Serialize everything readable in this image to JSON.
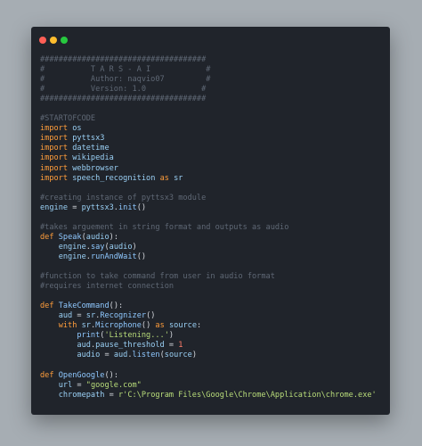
{
  "window": {
    "buttons": [
      {
        "name": "close-button",
        "color": "#ff5f56"
      },
      {
        "name": "minimize-button",
        "color": "#ffbd2e"
      },
      {
        "name": "maximize-button",
        "color": "#27c93f"
      }
    ]
  },
  "colors": {
    "background": "#a6adb3",
    "editor": "#20242b",
    "comment": "#5f6875",
    "keyword": "#ff9d3b",
    "identifier": "#9ad0f5",
    "string": "#b9dd7a",
    "number": "#ff7d6b"
  },
  "code": [
    [
      [
        "cm",
        "####################################"
      ]
    ],
    [
      [
        "cm",
        "#          T A R S - A I            #"
      ]
    ],
    [
      [
        "cm",
        "#          Author: naqvio07         #"
      ]
    ],
    [
      [
        "cm",
        "#          Version: 1.0            #"
      ]
    ],
    [
      [
        "cm",
        "####################################"
      ]
    ],
    [],
    [
      [
        "cm",
        "#STARTOFCODE"
      ]
    ],
    [
      [
        "kw",
        "import"
      ],
      [
        "op",
        " "
      ],
      [
        "id",
        "os"
      ]
    ],
    [
      [
        "kw",
        "import"
      ],
      [
        "op",
        " "
      ],
      [
        "id",
        "pyttsx3"
      ]
    ],
    [
      [
        "kw",
        "import"
      ],
      [
        "op",
        " "
      ],
      [
        "id",
        "datetime"
      ]
    ],
    [
      [
        "kw",
        "import"
      ],
      [
        "op",
        " "
      ],
      [
        "id",
        "wikipedia"
      ]
    ],
    [
      [
        "kw",
        "import"
      ],
      [
        "op",
        " "
      ],
      [
        "id",
        "webbrowser"
      ]
    ],
    [
      [
        "kw",
        "import"
      ],
      [
        "op",
        " "
      ],
      [
        "id",
        "speech_recognition"
      ],
      [
        "op",
        " "
      ],
      [
        "kw",
        "as"
      ],
      [
        "op",
        " "
      ],
      [
        "id",
        "sr"
      ]
    ],
    [],
    [
      [
        "cm",
        "#creating instance of pyttsx3 module"
      ]
    ],
    [
      [
        "id",
        "engine"
      ],
      [
        "op",
        " = "
      ],
      [
        "id",
        "pyttsx3"
      ],
      [
        "op",
        "."
      ],
      [
        "fn",
        "init"
      ],
      [
        "op",
        "()"
      ]
    ],
    [],
    [
      [
        "cm",
        "#takes arguement in string format and outputs as audio"
      ]
    ],
    [
      [
        "kw",
        "def"
      ],
      [
        "op",
        " "
      ],
      [
        "fn",
        "Speak"
      ],
      [
        "op",
        "("
      ],
      [
        "id",
        "audio"
      ],
      [
        "op",
        "):"
      ]
    ],
    [
      [
        "op",
        "    "
      ],
      [
        "id",
        "engine"
      ],
      [
        "op",
        "."
      ],
      [
        "fn",
        "say"
      ],
      [
        "op",
        "("
      ],
      [
        "id",
        "audio"
      ],
      [
        "op",
        ")"
      ]
    ],
    [
      [
        "op",
        "    "
      ],
      [
        "id",
        "engine"
      ],
      [
        "op",
        "."
      ],
      [
        "fn",
        "runAndWait"
      ],
      [
        "op",
        "()"
      ]
    ],
    [],
    [
      [
        "cm",
        "#function to take command from user in audio format"
      ]
    ],
    [
      [
        "cm",
        "#requires internet connection"
      ]
    ],
    [],
    [
      [
        "kw",
        "def"
      ],
      [
        "op",
        " "
      ],
      [
        "fn",
        "TakeCommand"
      ],
      [
        "op",
        "():"
      ]
    ],
    [
      [
        "op",
        "    "
      ],
      [
        "id",
        "aud"
      ],
      [
        "op",
        " = "
      ],
      [
        "id",
        "sr"
      ],
      [
        "op",
        "."
      ],
      [
        "fn",
        "Recognizer"
      ],
      [
        "op",
        "()"
      ]
    ],
    [
      [
        "op",
        "    "
      ],
      [
        "kw",
        "with"
      ],
      [
        "op",
        " "
      ],
      [
        "id",
        "sr"
      ],
      [
        "op",
        "."
      ],
      [
        "fn",
        "Microphone"
      ],
      [
        "op",
        "() "
      ],
      [
        "kw",
        "as"
      ],
      [
        "op",
        " "
      ],
      [
        "id",
        "source"
      ],
      [
        "op",
        ":"
      ]
    ],
    [
      [
        "op",
        "        "
      ],
      [
        "fn",
        "print"
      ],
      [
        "op",
        "("
      ],
      [
        "st",
        "'Listening...'"
      ],
      [
        "op",
        ")"
      ]
    ],
    [
      [
        "op",
        "        "
      ],
      [
        "id",
        "aud"
      ],
      [
        "op",
        "."
      ],
      [
        "id",
        "pause_threshold"
      ],
      [
        "op",
        " = "
      ],
      [
        "nm",
        "1"
      ]
    ],
    [
      [
        "op",
        "        "
      ],
      [
        "id",
        "audio"
      ],
      [
        "op",
        " = "
      ],
      [
        "id",
        "aud"
      ],
      [
        "op",
        "."
      ],
      [
        "fn",
        "listen"
      ],
      [
        "op",
        "("
      ],
      [
        "id",
        "source"
      ],
      [
        "op",
        ")"
      ]
    ],
    [],
    [
      [
        "kw",
        "def"
      ],
      [
        "op",
        " "
      ],
      [
        "fn",
        "OpenGoogle"
      ],
      [
        "op",
        "():"
      ]
    ],
    [
      [
        "op",
        "    "
      ],
      [
        "id",
        "url"
      ],
      [
        "op",
        " = "
      ],
      [
        "st",
        "\"google.com\""
      ]
    ],
    [
      [
        "op",
        "    "
      ],
      [
        "id",
        "chromepath"
      ],
      [
        "op",
        " = "
      ],
      [
        "st",
        "r'C:\\Program Files\\Google\\Chrome\\Application\\chrome.exe'"
      ]
    ]
  ]
}
